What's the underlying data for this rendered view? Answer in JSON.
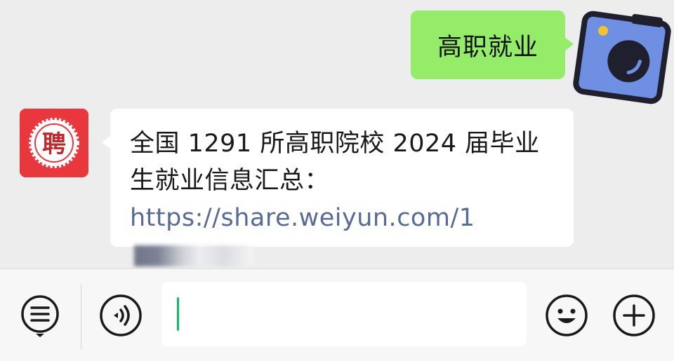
{
  "chat": {
    "outgoing": {
      "text": "高职就业"
    },
    "incoming": {
      "text_prefix": "全国 1291 所高职院校 2024 届毕业生就业信息汇总：",
      "link_text": "https://share.weiyun.com/1"
    },
    "bot_avatar": {
      "glyph": "聘"
    }
  },
  "toolbar": {
    "input_value": ""
  },
  "colors": {
    "background": "#ededed",
    "outgoing_bubble": "#95ec69",
    "incoming_bubble": "#ffffff",
    "link": "#576b95",
    "bot_avatar": "#e8383d",
    "caret": "#07c160"
  }
}
